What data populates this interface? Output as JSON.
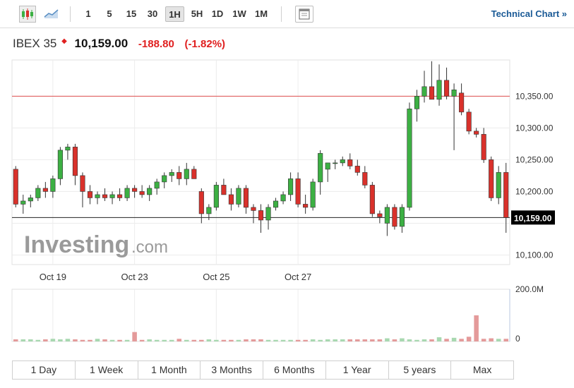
{
  "toolbar": {
    "intervals": [
      "1",
      "5",
      "15",
      "30",
      "1H",
      "5H",
      "1D",
      "1W",
      "1M"
    ],
    "active_interval": "1H",
    "technical_label": "Technical Chart »"
  },
  "quote": {
    "name": "IBEX 35",
    "price": "10,159.00",
    "change": "-188.80",
    "change_pct": "(-1.82%)"
  },
  "watermark": {
    "brand": "Investing",
    "suffix": ".com"
  },
  "ranges": [
    "1 Day",
    "1 Week",
    "1 Month",
    "3 Months",
    "6 Months",
    "1 Year",
    "5 years",
    "Max"
  ],
  "colors": {
    "up": "#3cb043",
    "down": "#d9312b",
    "vol_up": "#a8d8b0",
    "vol_down": "#e49a9a",
    "hline": "#e05050",
    "price_tag_bg": "#000000"
  },
  "chart_data": {
    "type": "candlestick",
    "x_tick_labels": [
      "Oct 19",
      "Oct 23",
      "Oct 25",
      "Oct 27"
    ],
    "x_tick_index": [
      5,
      16,
      27,
      38
    ],
    "y_ticks": [
      10100,
      10200,
      10250,
      10300,
      10350
    ],
    "y_tick_labels": [
      "10,100.00",
      "10,200.00",
      "10,250.00",
      "10,300.00",
      "10,350.00"
    ],
    "ylim": [
      10085,
      10407
    ],
    "reference_line": 10350,
    "current_price": 10159,
    "current_price_label": "10,159.00",
    "volume_ticks": [
      "200.0M",
      "0"
    ],
    "volume_max": 200,
    "candles": [
      [
        10235,
        10240,
        10175,
        10180
      ],
      [
        10180,
        10195,
        10165,
        10185
      ],
      [
        10185,
        10195,
        10175,
        10190
      ],
      [
        10190,
        10210,
        10185,
        10205
      ],
      [
        10205,
        10215,
        10190,
        10200
      ],
      [
        10200,
        10225,
        10190,
        10220
      ],
      [
        10220,
        10270,
        10210,
        10265
      ],
      [
        10265,
        10275,
        10250,
        10270
      ],
      [
        10270,
        10275,
        10210,
        10225
      ],
      [
        10225,
        10230,
        10175,
        10200
      ],
      [
        10200,
        10210,
        10180,
        10190
      ],
      [
        10190,
        10200,
        10180,
        10195
      ],
      [
        10195,
        10205,
        10185,
        10190
      ],
      [
        10190,
        10200,
        10180,
        10195
      ],
      [
        10195,
        10205,
        10185,
        10190
      ],
      [
        10190,
        10210,
        10185,
        10205
      ],
      [
        10205,
        10210,
        10190,
        10200
      ],
      [
        10200,
        10210,
        10190,
        10195
      ],
      [
        10195,
        10210,
        10185,
        10205
      ],
      [
        10205,
        10220,
        10195,
        10215
      ],
      [
        10215,
        10230,
        10205,
        10225
      ],
      [
        10225,
        10235,
        10215,
        10230
      ],
      [
        10230,
        10240,
        10210,
        10220
      ],
      [
        10220,
        10245,
        10210,
        10235
      ],
      [
        10235,
        10240,
        10220,
        10220
      ],
      [
        10200,
        10205,
        10150,
        10165
      ],
      [
        10165,
        10180,
        10155,
        10175
      ],
      [
        10175,
        10215,
        10170,
        10210
      ],
      [
        10210,
        10220,
        10195,
        10195
      ],
      [
        10195,
        10205,
        10170,
        10180
      ],
      [
        10180,
        10210,
        10175,
        10205
      ],
      [
        10205,
        10210,
        10165,
        10175
      ],
      [
        10175,
        10180,
        10150,
        10170
      ],
      [
        10170,
        10180,
        10135,
        10155
      ],
      [
        10155,
        10180,
        10140,
        10175
      ],
      [
        10175,
        10190,
        10170,
        10185
      ],
      [
        10185,
        10200,
        10180,
        10195
      ],
      [
        10195,
        10230,
        10185,
        10220
      ],
      [
        10220,
        10230,
        10175,
        10180
      ],
      [
        10180,
        10195,
        10165,
        10175
      ],
      [
        10175,
        10220,
        10170,
        10215
      ],
      [
        10215,
        10265,
        10195,
        10260
      ],
      [
        10235,
        10245,
        10215,
        10245
      ],
      [
        10245,
        10250,
        10235,
        10245
      ],
      [
        10245,
        10255,
        10240,
        10250
      ],
      [
        10250,
        10260,
        10235,
        10240
      ],
      [
        10240,
        10250,
        10225,
        10230
      ],
      [
        10230,
        10240,
        10205,
        10210
      ],
      [
        10210,
        10215,
        10160,
        10165
      ],
      [
        10165,
        10170,
        10150,
        10160
      ],
      [
        10150,
        10180,
        10130,
        10175
      ],
      [
        10175,
        10180,
        10140,
        10145
      ],
      [
        10145,
        10180,
        10135,
        10175
      ],
      [
        10175,
        10340,
        10170,
        10330
      ],
      [
        10330,
        10360,
        10310,
        10350
      ],
      [
        10350,
        10390,
        10340,
        10365
      ],
      [
        10365,
        10405,
        10345,
        10345
      ],
      [
        10345,
        10400,
        10335,
        10375
      ],
      [
        10375,
        10395,
        10345,
        10350
      ],
      [
        10350,
        10370,
        10265,
        10360
      ],
      [
        10355,
        10370,
        10320,
        10325
      ],
      [
        10325,
        10330,
        10290,
        10295
      ],
      [
        10295,
        10300,
        10285,
        10290
      ],
      [
        10290,
        10300,
        10245,
        10250
      ],
      [
        10250,
        10255,
        10185,
        10190
      ],
      [
        10190,
        10240,
        10180,
        10230
      ],
      [
        10230,
        10245,
        10135,
        10159
      ]
    ],
    "volumes": [
      8,
      8,
      8,
      8,
      6,
      6,
      8,
      8,
      12,
      10,
      28,
      8,
      10,
      12,
      8,
      6,
      6,
      6,
      6,
      6,
      10,
      40,
      8,
      6,
      6,
      6,
      12,
      6,
      16,
      36,
      6,
      6,
      6,
      8,
      6,
      6,
      6,
      6,
      6,
      8,
      10,
      10,
      6,
      6,
      6,
      6,
      40,
      8,
      6,
      6,
      6,
      6,
      6,
      6,
      6,
      6,
      8,
      6,
      8,
      40,
      8,
      8,
      6,
      8,
      6,
      6,
      6,
      6,
      6,
      6,
      8,
      6,
      6,
      8,
      6,
      6,
      8,
      8,
      8,
      8,
      8,
      8,
      8,
      8,
      8,
      6,
      8,
      20,
      8,
      8,
      8,
      12,
      6,
      8,
      10,
      12,
      18,
      8,
      8,
      6,
      8,
      10,
      8,
      20,
      16,
      14,
      10,
      20,
      14,
      8,
      10,
      18,
      12,
      100,
      14,
      10,
      10,
      12,
      14,
      10,
      10,
      10,
      10
    ]
  }
}
